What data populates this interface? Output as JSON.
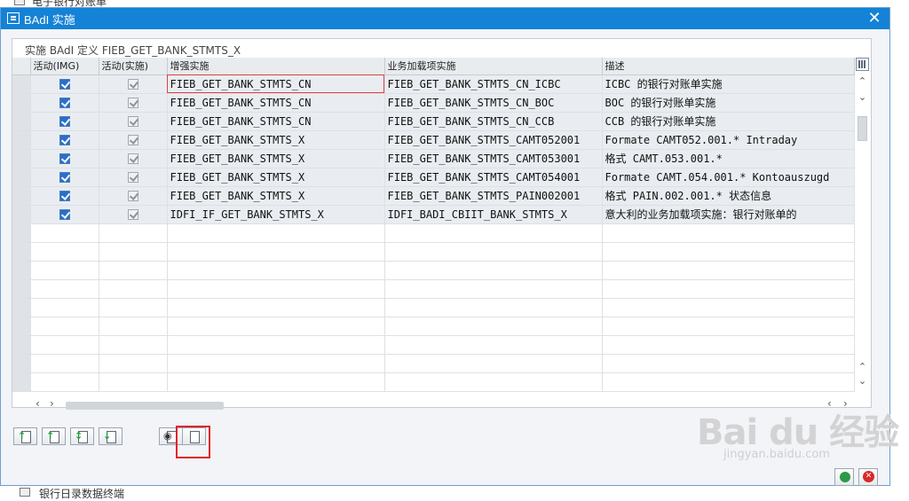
{
  "background": {
    "top_text": "电子银行对账单",
    "bottom_text": "银行日录数据终端"
  },
  "dialog": {
    "title": "BAdI 实施",
    "close_label": "✕"
  },
  "panel": {
    "title": "实施 BAdI 定义 FIEB_GET_BANK_STMTS_X",
    "columns": [
      "活动(IMG)",
      "活动(实施)",
      "增强实施",
      "业务加载项实施",
      "描述"
    ],
    "rows": [
      {
        "enh": "FIEB_GET_BANK_STMTS_CN",
        "impl": "FIEB_GET_BANK_STMTS_CN_ICBC",
        "desc": "ICBC 的银行对账单实施"
      },
      {
        "enh": "FIEB_GET_BANK_STMTS_CN",
        "impl": "FIEB_GET_BANK_STMTS_CN_BOC",
        "desc": "BOC 的银行对账单实施"
      },
      {
        "enh": "FIEB_GET_BANK_STMTS_CN",
        "impl": "FIEB_GET_BANK_STMTS_CN_CCB",
        "desc": "CCB 的银行对账单实施"
      },
      {
        "enh": "FIEB_GET_BANK_STMTS_X",
        "impl": "FIEB_GET_BANK_STMTS_CAMT052001",
        "desc": "Formate CAMT052.001.* Intraday"
      },
      {
        "enh": "FIEB_GET_BANK_STMTS_X",
        "impl": "FIEB_GET_BANK_STMTS_CAMT053001",
        "desc": "格式 CAMT.053.001.*"
      },
      {
        "enh": "FIEB_GET_BANK_STMTS_X",
        "impl": "FIEB_GET_BANK_STMTS_CAMT054001",
        "desc": "Formate CAMT.054.001.* Kontoauszugd"
      },
      {
        "enh": "FIEB_GET_BANK_STMTS_X",
        "impl": "FIEB_GET_BANK_STMTS_PAIN002001",
        "desc": "格式 PAIN.002.001.* 状态信息"
      },
      {
        "enh": "IDFI_IF_GET_BANK_STMTS_X",
        "impl": "IDFI_BADI_CBIIT_BANK_STMTS_X",
        "desc": "意大利的业务加载项实施：银行对账单的"
      }
    ]
  },
  "watermark": {
    "logo": "Bai du 经验",
    "url": "jingyan.baidu.com"
  }
}
